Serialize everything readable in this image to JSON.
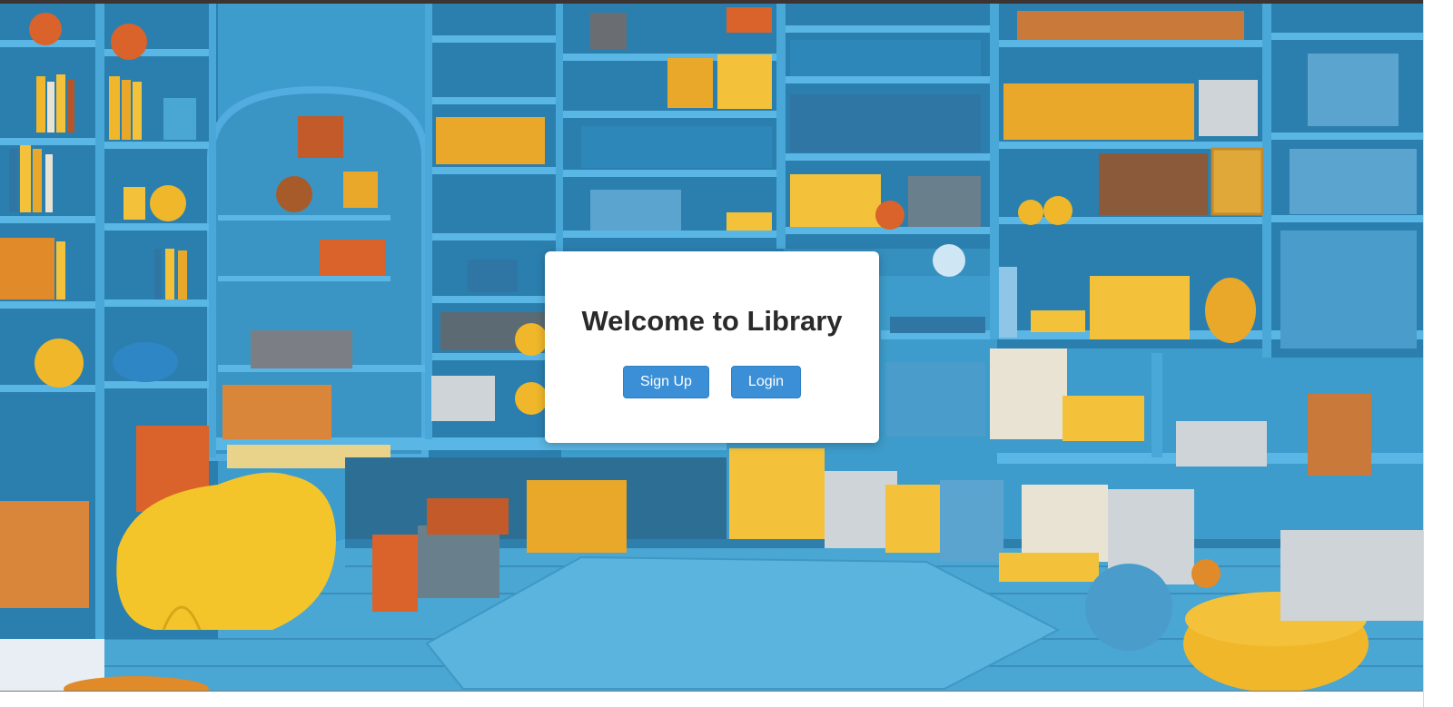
{
  "hero": {
    "title": "Welcome to Library",
    "signup_label": "Sign Up",
    "login_label": "Login"
  },
  "background": {
    "description_name": "library-room-illustration"
  },
  "colors": {
    "accent": "#3a8fd6",
    "wall": "#3c9fcd",
    "shelf": "#2f86b5",
    "card_bg": "#ffffff",
    "title_text": "#2a2a2a"
  }
}
